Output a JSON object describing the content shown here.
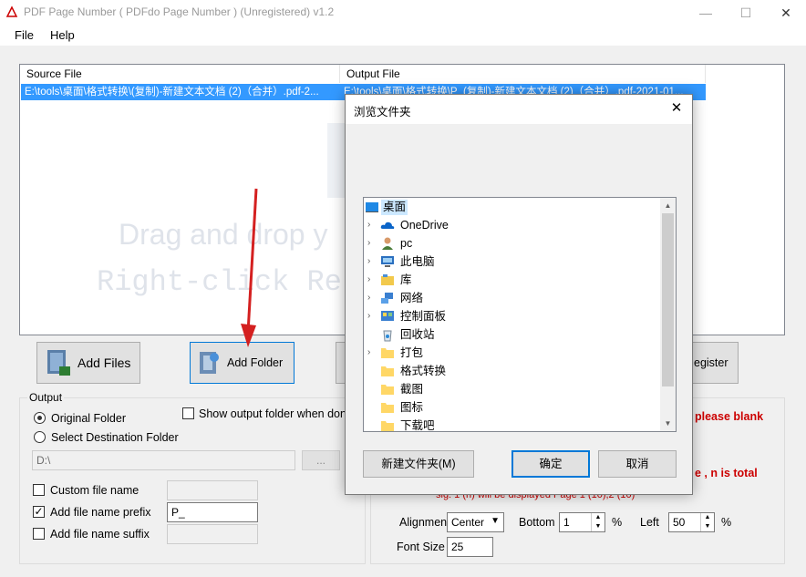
{
  "window": {
    "title": "PDF Page Number ( PDFdo Page Number )  (Unregistered) v1.2",
    "minimize": "—",
    "maximize": "☐",
    "close": "✕"
  },
  "menu": [
    "File",
    "Help"
  ],
  "list": {
    "columns": [
      "Source File",
      "Output File"
    ],
    "rows": [
      {
        "source": "E:\\tools\\桌面\\格式转换\\(复制)-新建文本文档 (2)（合并）.pdf-2...",
        "output": "E:\\tools\\桌面\\格式转换\\P_(复制)-新建文本文档 (2)（合并）.pdf-2021-01..."
      }
    ],
    "watermark_line1": "Drag and drop y",
    "watermark_line2": "Right-click Re"
  },
  "toolbar": {
    "add_files": "Add Files",
    "add_folder": "Add Folder",
    "register": "egister"
  },
  "output": {
    "label": "Output",
    "original_folder": "Original Folder",
    "select_destination": "Select Destination Folder",
    "show_output_folder": "Show output folder when don",
    "path": "D:\\",
    "browse": "...",
    "custom_file_name": "Custom file name",
    "custom_file_name_checked": false,
    "add_prefix": "Add file name prefix",
    "add_prefix_checked": true,
    "prefix_value": "P_",
    "add_suffix": "Add file name suffix",
    "add_suffix_checked": false
  },
  "settings": {
    "note1": "please blank",
    "note2": "e , n is total",
    "note3": "sig: 1 (n) will be displayed Page 1 (10),2 (10)",
    "alignment_label": "Alignmen",
    "alignment_value": "Center",
    "bottom_label": "Bottom",
    "bottom_value": "1",
    "bottom_unit": "%",
    "left_label": "Left",
    "left_value": "50",
    "left_unit": "%",
    "font_size_label": "Font Size",
    "font_size_value": "25"
  },
  "dialog": {
    "title": "浏览文件夹",
    "close": "✕",
    "items": [
      {
        "label": "桌面",
        "icon": "desktop-icon",
        "expandable": false,
        "selected": true
      },
      {
        "label": "OneDrive",
        "icon": "cloud-icon",
        "expandable": true
      },
      {
        "label": "pc",
        "icon": "user-icon",
        "expandable": true
      },
      {
        "label": "此电脑",
        "icon": "computer-icon",
        "expandable": true
      },
      {
        "label": "库",
        "icon": "library-icon",
        "expandable": true
      },
      {
        "label": "网络",
        "icon": "network-icon",
        "expandable": true
      },
      {
        "label": "控制面板",
        "icon": "control-panel-icon",
        "expandable": true
      },
      {
        "label": "回收站",
        "icon": "recycle-bin-icon",
        "expandable": false
      },
      {
        "label": "打包",
        "icon": "folder-icon",
        "expandable": true
      },
      {
        "label": "格式转换",
        "icon": "folder-icon",
        "expandable": false
      },
      {
        "label": "截图",
        "icon": "folder-icon",
        "expandable": false
      },
      {
        "label": "图标",
        "icon": "folder-icon",
        "expandable": false
      },
      {
        "label": "下载吧",
        "icon": "folder-icon",
        "expandable": false
      }
    ],
    "new_folder": "新建文件夹(M)",
    "ok": "确定",
    "cancel": "取消"
  },
  "colors": {
    "selection": "#3399ff",
    "accent": "#0078d7",
    "warning": "#cc0000",
    "arrow": "#d42020"
  }
}
